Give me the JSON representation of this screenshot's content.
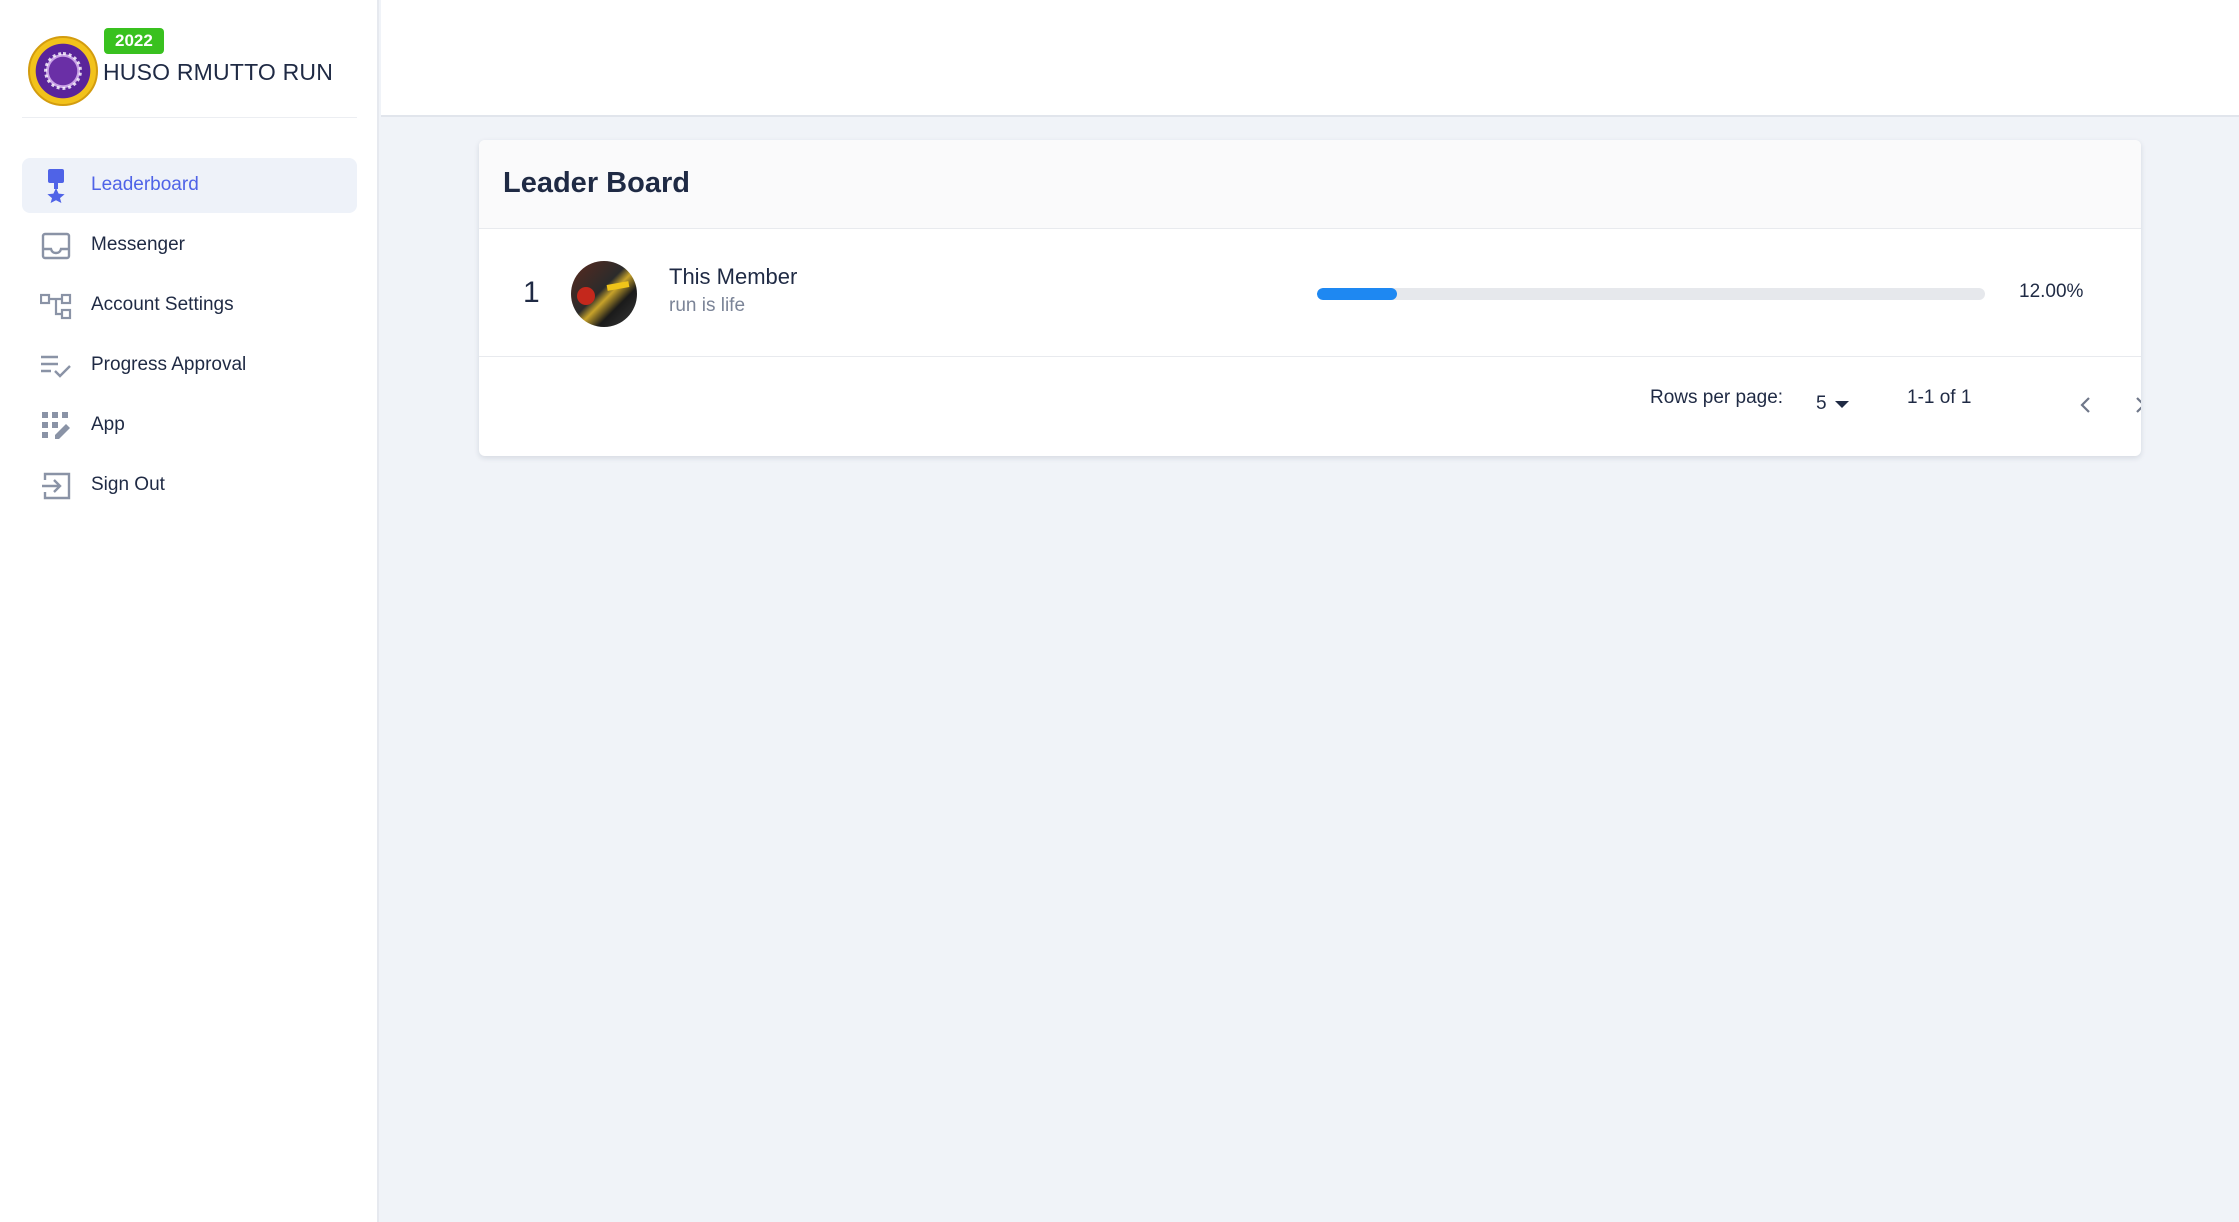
{
  "brand": {
    "year_badge": "2022",
    "name": "HUSO RMUTTO RUN",
    "colors": {
      "badge": "#39c11f",
      "logo_primary": "#6a2fa6",
      "logo_secondary": "#f2c21b"
    }
  },
  "sidebar": {
    "items": [
      {
        "label": "Leaderboard",
        "icon": "medal-icon",
        "active": true
      },
      {
        "label": "Messenger",
        "icon": "inbox-icon",
        "active": false
      },
      {
        "label": "Account Settings",
        "icon": "sitemap-icon",
        "active": false
      },
      {
        "label": "Progress Approval",
        "icon": "list-check-icon",
        "active": false
      },
      {
        "label": "App",
        "icon": "app-grid-edit-icon",
        "active": false
      },
      {
        "label": "Sign Out",
        "icon": "sign-out-icon",
        "active": false
      }
    ]
  },
  "leaderboard": {
    "title": "Leader Board",
    "rows": [
      {
        "rank": "1",
        "name": "This Member",
        "subtitle": "run is life",
        "progress": 0.12,
        "progress_text": "12.00%"
      }
    ],
    "pagination": {
      "rows_per_page_label": "Rows per page:",
      "rows_per_page_value": "5",
      "range": "1-1 of 1"
    }
  },
  "colors": {
    "accent": "#4f63e7",
    "progress": "#1e88f2",
    "background": "#f0f3f8"
  }
}
